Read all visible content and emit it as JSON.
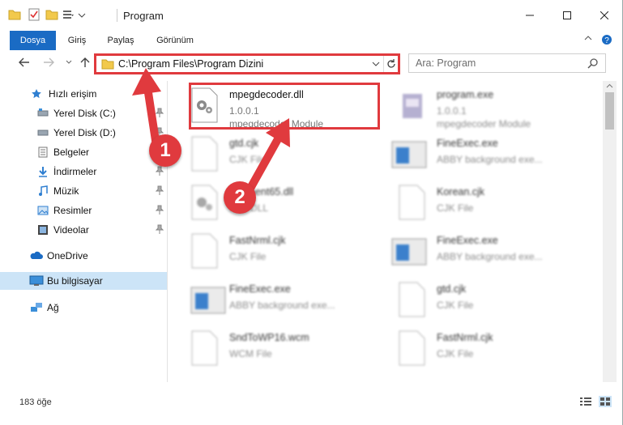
{
  "window": {
    "title": "Program"
  },
  "ribbon": {
    "tabs": [
      {
        "label": "Dosya",
        "active": true
      },
      {
        "label": "Giriş",
        "active": false
      },
      {
        "label": "Paylaş",
        "active": false
      },
      {
        "label": "Görünüm",
        "active": false
      }
    ]
  },
  "address": {
    "path": "C:\\Program Files\\Program Dizini"
  },
  "search": {
    "placeholder": "Ara: Program"
  },
  "sidebar": {
    "items": [
      {
        "label": "Hızlı erişim",
        "icon": "star-icon"
      },
      {
        "label": "Yerel Disk (C:)",
        "icon": "drive-icon",
        "pinned": true
      },
      {
        "label": "Yerel Disk (D:)",
        "icon": "drive-icon",
        "pinned": true
      },
      {
        "label": "Belgeler",
        "icon": "document-icon",
        "pinned": true
      },
      {
        "label": "İndirmeler",
        "icon": "download-icon",
        "pinned": true
      },
      {
        "label": "Müzik",
        "icon": "music-icon",
        "pinned": true
      },
      {
        "label": "Resimler",
        "icon": "pictures-icon",
        "pinned": true
      },
      {
        "label": "Videolar",
        "icon": "video-icon",
        "pinned": true
      },
      {
        "label": "OneDrive",
        "icon": "cloud-icon"
      },
      {
        "label": "Bu bilgisayar",
        "icon": "computer-icon",
        "selected": true
      },
      {
        "label": "Ağ",
        "icon": "network-icon"
      }
    ]
  },
  "files": [
    {
      "name": "mpegdecoder.dll",
      "line2": "1.0.0.1",
      "line3": "mpegdecoder Module",
      "icon": "dll-gear-icon",
      "highlighted": true
    },
    {
      "name": "program.exe",
      "line2": "1.0.0.1",
      "line3": "mpegdecoder Module",
      "icon": "exe-icon"
    },
    {
      "name": "gtd.cjk",
      "line2": "CJK File",
      "icon": "blank-file-icon"
    },
    {
      "name": "FineExec.exe",
      "line2": "ABBY background exe...",
      "icon": "window-app-icon"
    },
    {
      "name": "...eClient65.dll",
      "line2": "...ce DLL",
      "icon": "dll-gear-icon"
    },
    {
      "name": "Korean.cjk",
      "line2": "CJK File",
      "icon": "blank-file-icon"
    },
    {
      "name": "FastNrml.cjk",
      "line2": "CJK File",
      "icon": "blank-file-icon"
    },
    {
      "name": "FineExec.exe",
      "line2": "ABBY background exe...",
      "icon": "window-app-icon"
    },
    {
      "name": "FineExec.exe",
      "line2": "ABBY background exe...",
      "icon": "window-app-icon"
    },
    {
      "name": "gtd.cjk",
      "line2": "CJK File",
      "icon": "blank-file-icon"
    },
    {
      "name": "SndToWP16.wcm",
      "line2": "WCM File",
      "icon": "blank-file-icon"
    },
    {
      "name": "FastNrml.cjk",
      "line2": "CJK File",
      "icon": "blank-file-icon"
    }
  ],
  "status": {
    "item_count": "183 öğe"
  },
  "annotations": {
    "badge1": "1",
    "badge2": "2"
  },
  "colors": {
    "accent": "#1a6bc4",
    "highlight": "#e03a3e",
    "selected": "#cce4f7"
  }
}
